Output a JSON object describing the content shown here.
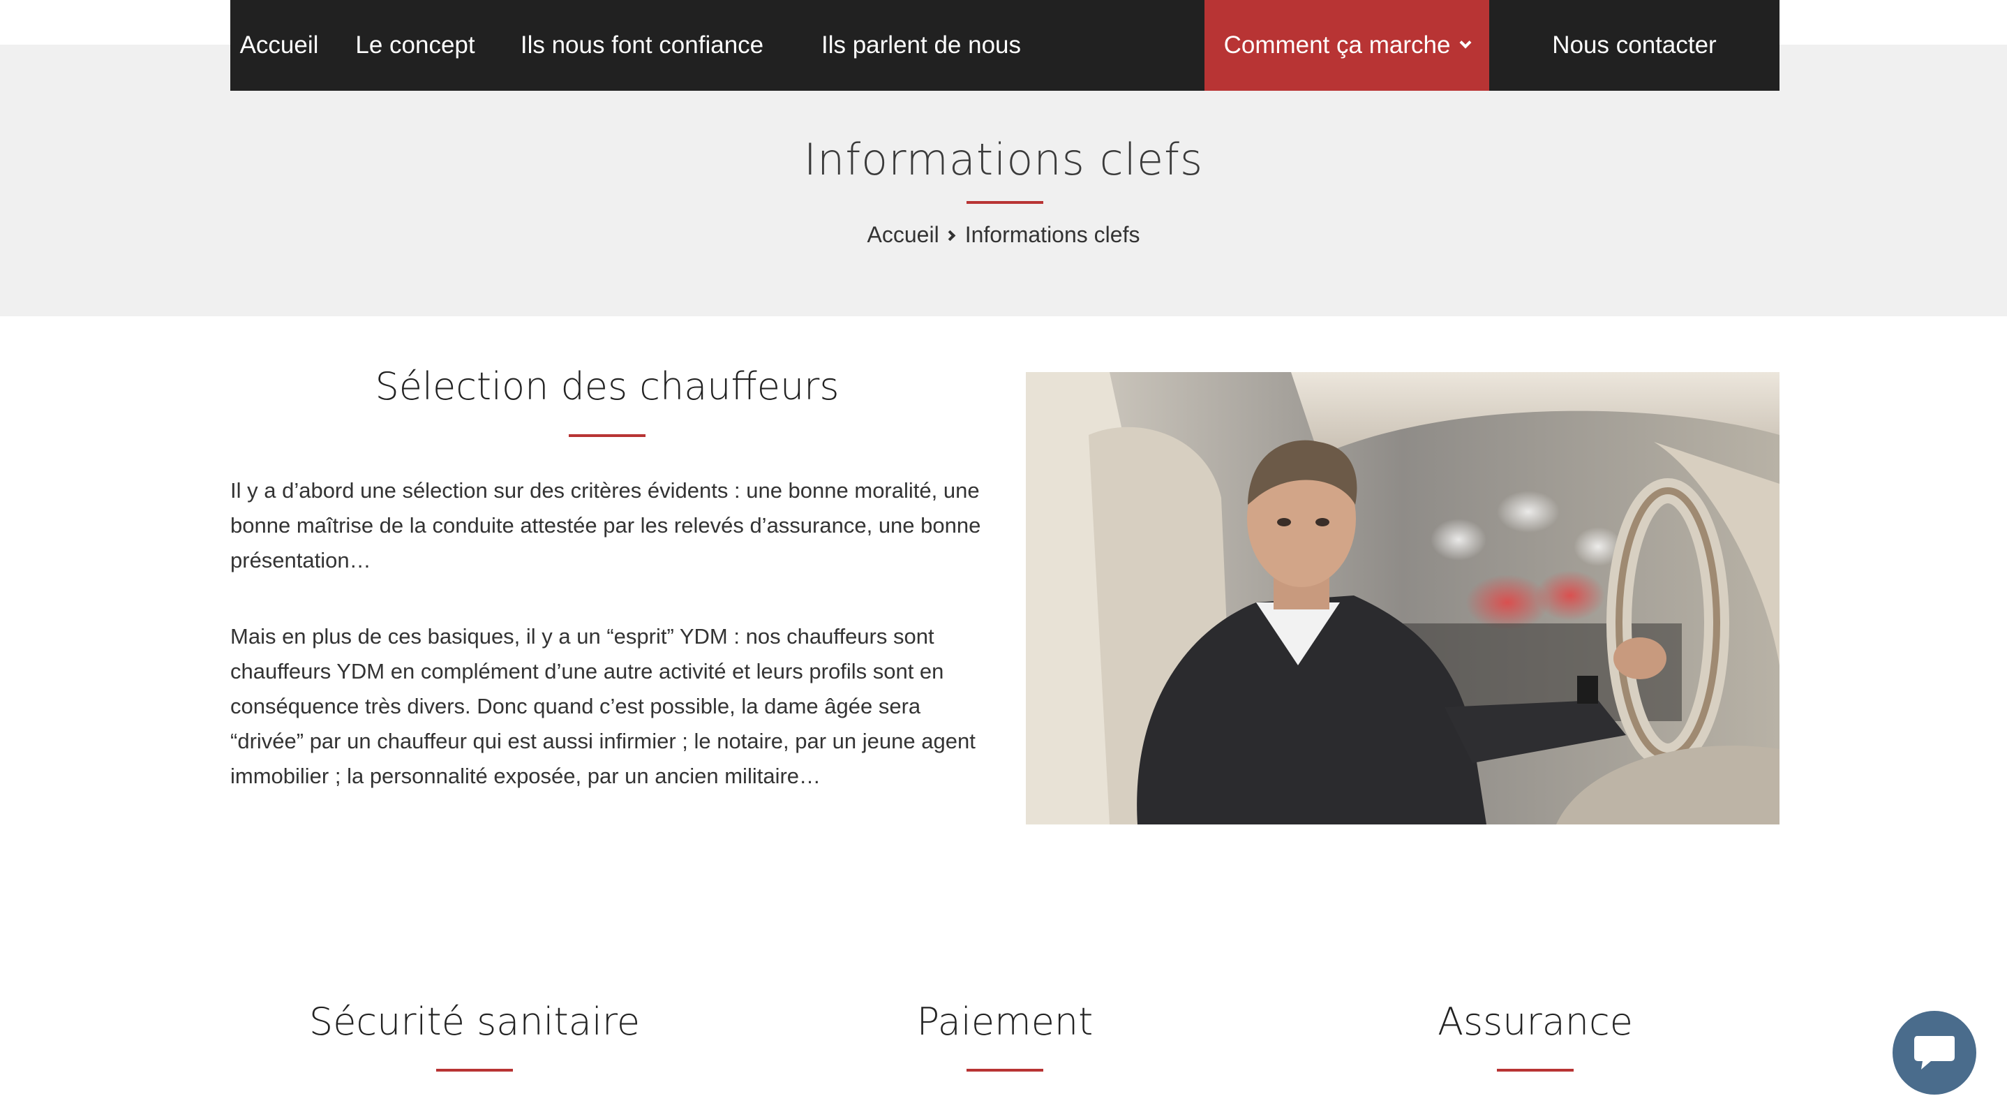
{
  "nav": {
    "items": [
      {
        "label": "Accueil"
      },
      {
        "label": "Le concept"
      },
      {
        "label": "Ils nous font confiance"
      },
      {
        "label": "Ils parlent de nous"
      },
      {
        "label": "Comment ça marche",
        "active": true,
        "has_dropdown": true
      },
      {
        "label": "Nous contacter"
      }
    ]
  },
  "page": {
    "title": "Informations clefs",
    "breadcrumb": [
      "Accueil",
      "Informations clefs"
    ]
  },
  "selection": {
    "title": "Sélection des chauffeurs",
    "paragraphs": [
      "Il y a d’abord une sélection sur des critères évidents : une bonne moralité, une bonne maîtrise de la conduite attestée par les relevés d’assurance, une bonne présentation…",
      "Mais en plus de ces basiques, il y a un “esprit” YDM : nos chauffeurs sont chauffeurs YDM en complément d’une autre activité et leurs profils sont en conséquence très divers. Donc quand c’est possible, la dame âgée sera “drivée” par un chauffeur qui est aussi infirmier ; le notaire, par un jeune agent immobilier ; la personnalité exposée, par un ancien militaire…"
    ]
  },
  "features": [
    {
      "title": "Sécurité sanitaire"
    },
    {
      "title": "Paiement"
    },
    {
      "title": "Assurance"
    }
  ],
  "chat": {
    "icon": "chat-bubble-icon"
  },
  "colors": {
    "accent": "#b83434",
    "nav_bg": "#212121",
    "hero_bg": "#f0f0f0",
    "chat_bg": "#4a6c8c"
  }
}
